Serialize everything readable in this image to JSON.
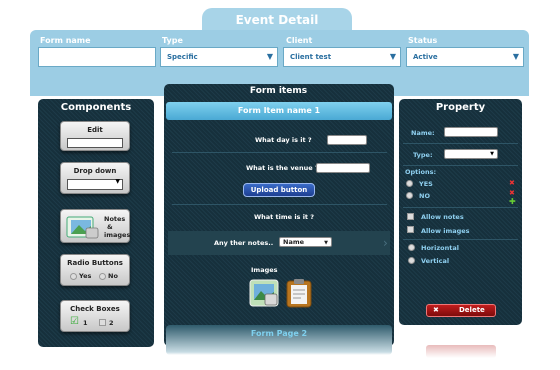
{
  "title": "Event Detail",
  "header": {
    "form_name_label": "Form name",
    "form_name_value": "",
    "type_label": "Type",
    "type_value": "Specific",
    "client_label": "Client",
    "client_value": "Client test",
    "status_label": "Status",
    "status_value": "Active"
  },
  "components": {
    "title": "Components",
    "edit": "Edit",
    "dropdown": "Drop down",
    "notes_label_1": "Notes",
    "notes_label_2": "&",
    "notes_label_3": "images",
    "radio": "Radio Buttons",
    "radio_yes": "Yes",
    "radio_no": "No",
    "checkboxes": "Check Boxes",
    "check_1": "1",
    "check_2": "2"
  },
  "form_items": {
    "title": "Form items",
    "item_name": "Form Item name 1",
    "q1": "What day is it ?",
    "q2": "What is the venue ?",
    "upload": "Upload button",
    "q3": "What time is it ?",
    "q4": "Any ther notes..",
    "q4_select": "Name",
    "images_label": "Images",
    "page2": "Form Page 2"
  },
  "property": {
    "title": "Property",
    "name_label": "Name:",
    "type_label": "Type:",
    "options_label": "Options:",
    "opt_yes": "YES",
    "opt_no": "NO",
    "allow_notes": "Allow notes",
    "allow_images": "Allow images",
    "horizontal": "Horizontal",
    "vertical": "Vertical",
    "delete": "Delete"
  }
}
